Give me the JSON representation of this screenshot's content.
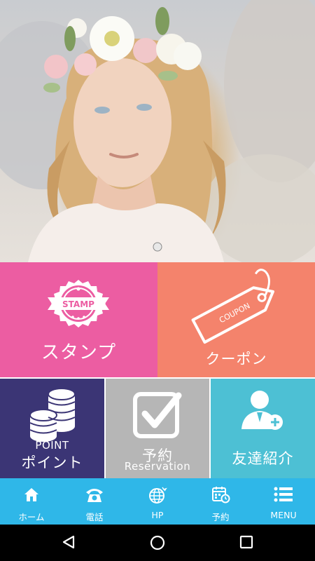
{
  "hero": {
    "image": "girl-with-flower-crown-photo"
  },
  "tiles": {
    "stamp": {
      "badge": "STAMP",
      "label": "スタンプ",
      "color": "#ec5da2"
    },
    "coupon": {
      "tag": "COUPON",
      "label": "クーポン",
      "color": "#f4836c"
    },
    "point": {
      "label_en": "POINT",
      "label": "ポイント",
      "color": "#3b3575"
    },
    "reservation": {
      "label": "予約",
      "label_en": "Reservation",
      "color": "#b6b6b6"
    },
    "friend": {
      "label": "友達紹介",
      "color": "#4dc0d4"
    }
  },
  "tabbar": {
    "color": "#2fb7e8",
    "items": [
      {
        "icon": "home-icon",
        "label": "ホーム"
      },
      {
        "icon": "phone-icon",
        "label": "電話"
      },
      {
        "icon": "globe-icon",
        "label": "HP"
      },
      {
        "icon": "calendar-icon",
        "label": "予約"
      },
      {
        "icon": "menu-icon",
        "label": "MENU"
      }
    ]
  },
  "navbar": {
    "buttons": [
      "back-icon",
      "home-circle-icon",
      "recents-icon"
    ]
  }
}
